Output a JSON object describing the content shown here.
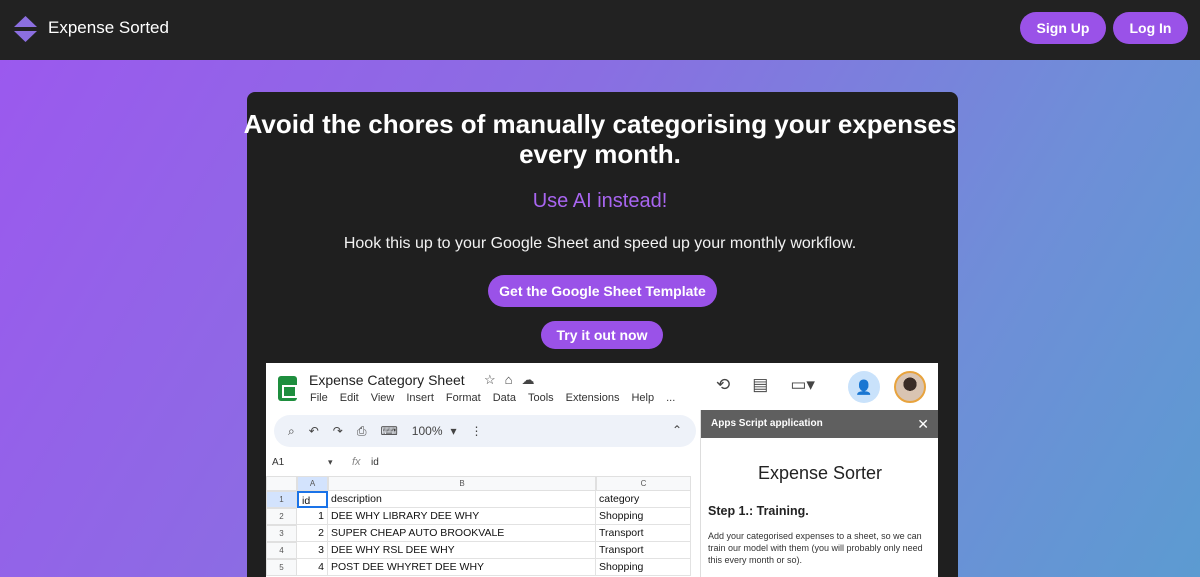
{
  "nav": {
    "brand": "Expense Sorted",
    "signup_label": "Sign Up",
    "login_label": "Log In",
    "logo_icon": "diamond-chevrons-icon",
    "accent_color": "#9a52e8"
  },
  "hero": {
    "headline_line1": "Avoid the chores of manually categorising your expenses",
    "headline_line2": "every month.",
    "subheadline": "Use AI instead!",
    "description": "Hook this up to your Google Sheet and speed up your monthly workflow.",
    "template_button": "Get the Google Sheet Template",
    "try_button": "Try it out now"
  },
  "sheet": {
    "title": "Expense Category Sheet",
    "menu": [
      "File",
      "Edit",
      "View",
      "Insert",
      "Format",
      "Data",
      "Tools",
      "Extensions",
      "Help",
      "..."
    ],
    "zoom": "100%",
    "cell_ref": "A1",
    "formula_value": "id",
    "fx_label": "fx",
    "columns": [
      "A",
      "B",
      "C"
    ],
    "rows": [
      {
        "num": "1",
        "id": "id",
        "description": "description",
        "category": "category"
      },
      {
        "num": "2",
        "id": "1",
        "description": "DEE WHY LIBRARY DEE WHY",
        "category": "Shopping"
      },
      {
        "num": "3",
        "id": "2",
        "description": "SUPER CHEAP AUTO BROOKVALE",
        "category": "Transport"
      },
      {
        "num": "4",
        "id": "3",
        "description": "DEE WHY RSL DEE WHY",
        "category": "Transport"
      },
      {
        "num": "5",
        "id": "4",
        "description": "POST DEE WHYRET DEE WHY",
        "category": "Shopping"
      }
    ]
  },
  "panel": {
    "header": "Apps Script application",
    "close": "✕",
    "title": "Expense Sorter",
    "step": "Step 1.: Training.",
    "text": "Add your categorised expenses to a sheet, so we can train our model with them (you will probably only need this every month or so)."
  }
}
